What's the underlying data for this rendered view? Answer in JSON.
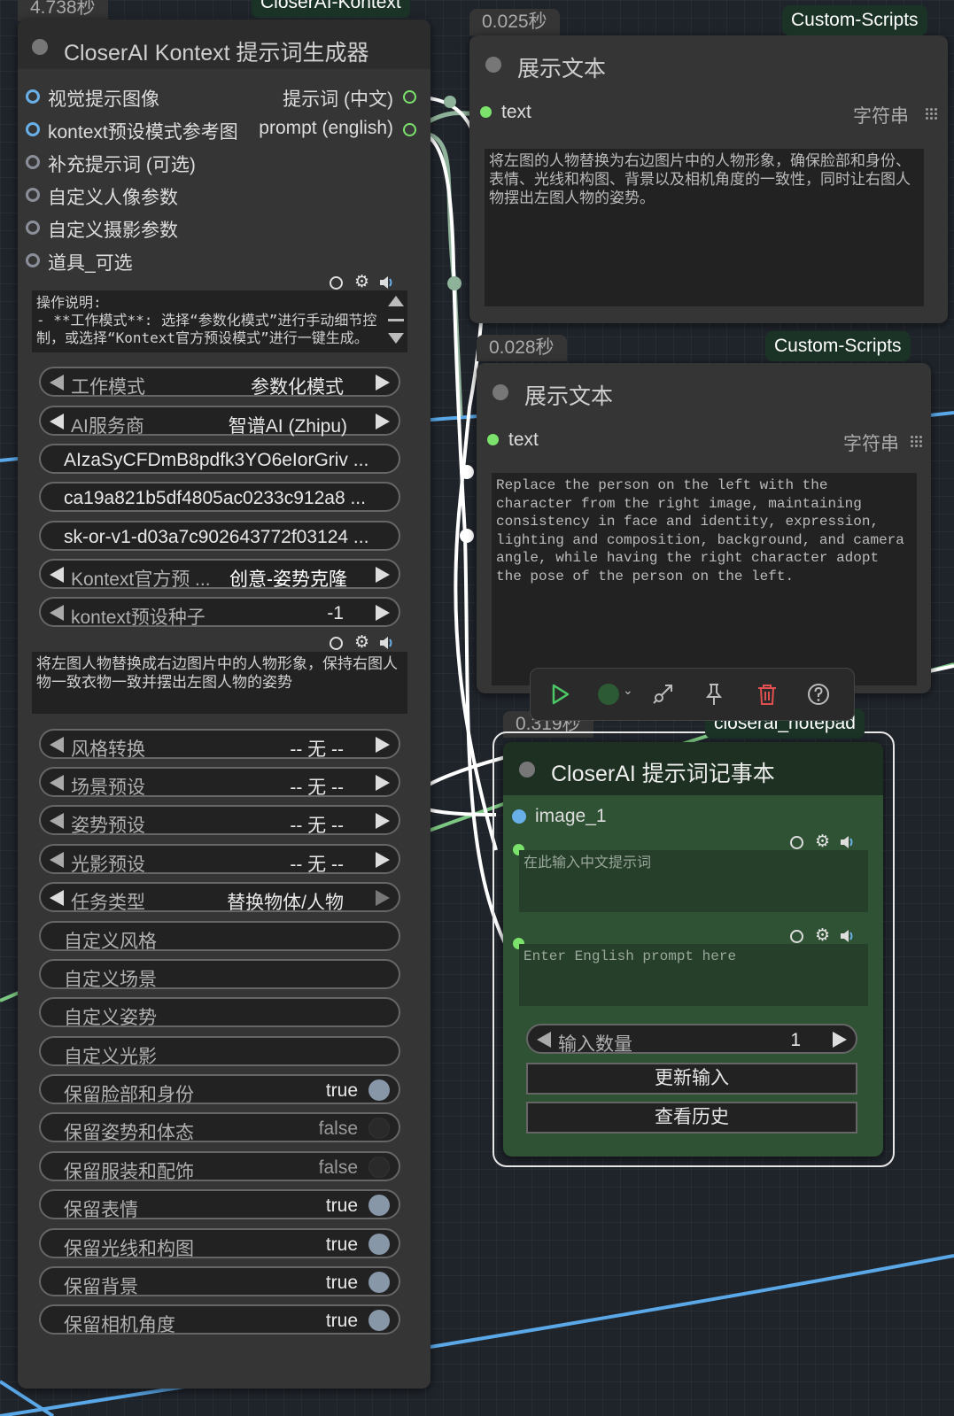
{
  "colors": {
    "canvas_bg": "#1f242b",
    "node_bg": "#353535",
    "notepad_bg": "#2f5134",
    "tag_bg": "#1b3226",
    "link_blue": "#5aa8e8",
    "link_green": "#7cc782",
    "slot_green": "#7be36b",
    "delete_red": "#e05050"
  },
  "kontext_node": {
    "time": "4.738秒",
    "tag": "CloserAI-Kontext",
    "title": "CloserAI Kontext 提示词生成器",
    "inputs": [
      "视觉提示图像",
      "kontext预设模式参考图",
      "补充提示词 (可选)",
      "自定义人像参数",
      "自定义摄影参数",
      "道具_可选"
    ],
    "outputs": [
      "提示词 (中文)",
      "prompt (english)"
    ],
    "instructions": "操作说明:\n- **工作模式**: 选择“参数化模式”进行手动细节控制，或选择“Kontext官方预设模式”进行一键生成。",
    "mode_label": "工作模式",
    "mode_value": "参数化模式",
    "provider_label": "AI服务商",
    "provider_value": "智谱AI (Zhipu)",
    "key1": "AIzaSyCFDmB8pdfk3YO6eIorGriv ...",
    "key2": "ca19a821b5df4805ac0233c912a8 ...",
    "key3": "sk-or-v1-d03a7c902643772f03124 ...",
    "preset_label": "Kontext官方预 ...",
    "preset_value": "创意-姿势克隆",
    "seed_label": "kontext预设种子",
    "seed_value": "-1",
    "supplement_text": "将左图人物替换成右边图片中的人物形象，保持右图人物一致衣物一致并摆出左图人物的姿势",
    "style_label": "风格转换",
    "style_value": "-- 无 --",
    "scene_label": "场景预设",
    "scene_value": "-- 无 --",
    "pose_label": "姿势预设",
    "pose_value": "-- 无 --",
    "light_label": "光影预设",
    "light_value": "-- 无 --",
    "task_label": "任务类型",
    "task_value": "替换物体/人物",
    "custom_style": "自定义风格",
    "custom_scene": "自定义场景",
    "custom_pose": "自定义姿势",
    "custom_light": "自定义光影",
    "toggles": [
      {
        "label": "保留脸部和身份",
        "value": "true"
      },
      {
        "label": "保留姿势和体态",
        "value": "false"
      },
      {
        "label": "保留服装和配饰",
        "value": "false"
      },
      {
        "label": "保留表情",
        "value": "true"
      },
      {
        "label": "保留光线和构图",
        "value": "true"
      },
      {
        "label": "保留背景",
        "value": "true"
      },
      {
        "label": "保留相机角度",
        "value": "true"
      }
    ]
  },
  "display1": {
    "time": "0.025秒",
    "tag": "Custom-Scripts",
    "title": "展示文本",
    "input_label": "text",
    "type_label": "字符串",
    "text": "将左图的人物替换为右边图片中的人物形象，确保脸部和身份、表情、光线和构图、背景以及相机角度的一致性，同时让右图人物摆出左图人物的姿势。"
  },
  "display2": {
    "time": "0.028秒",
    "tag": "Custom-Scripts",
    "title": "展示文本",
    "input_label": "text",
    "type_label": "字符串",
    "text": "Replace the person on the left with the character from the right image, maintaining consistency in face and identity, expression, lighting and composition, background, and camera angle, while having the right character adopt the pose of the person on the left."
  },
  "toolbar": {
    "icons": [
      "play-icon",
      "color-icon",
      "bypass-icon",
      "pin-icon",
      "delete-icon",
      "help-icon"
    ]
  },
  "notepad": {
    "time": "0.319秒",
    "tag": "closerai_notepad",
    "title": "CloserAI 提示词记事本",
    "image_label": "image_1",
    "cn_placeholder": "在此输入中文提示词",
    "en_placeholder": "Enter English prompt here",
    "count_label": "输入数量",
    "count_value": "1",
    "update_button": "更新输入",
    "history_button": "查看历史"
  }
}
